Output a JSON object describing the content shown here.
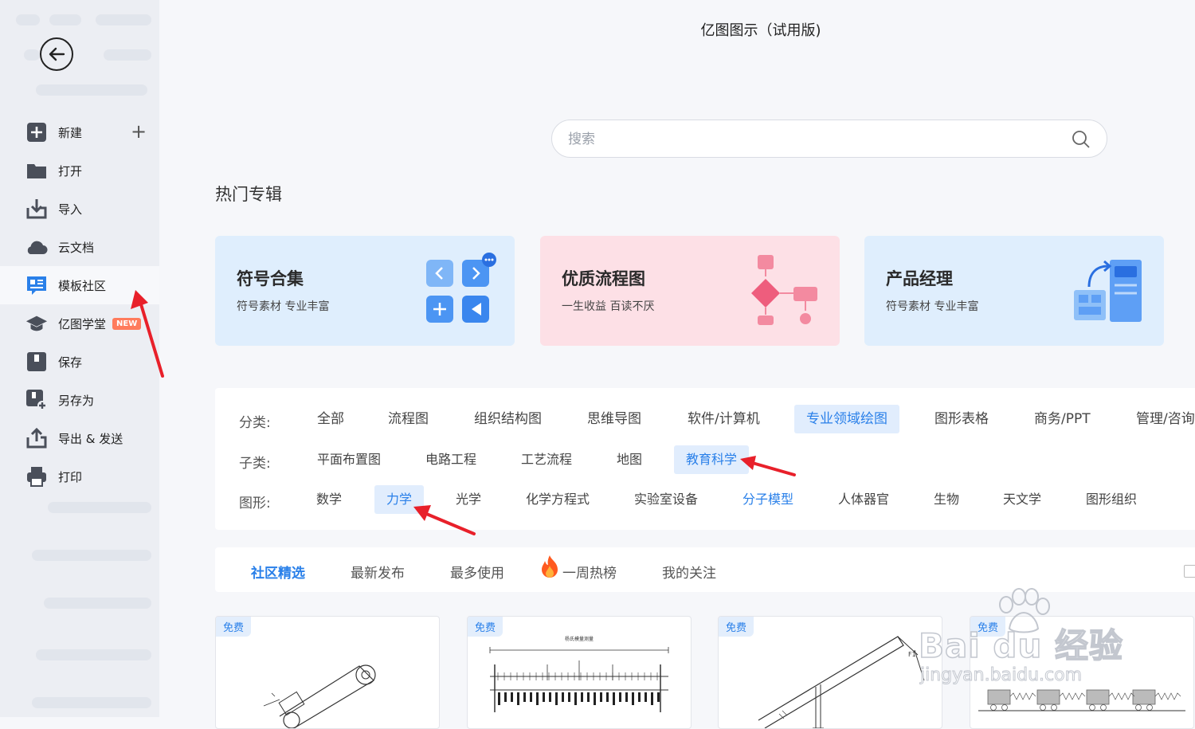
{
  "app_title": "亿图图示（试用版)",
  "sidebar": {
    "items": [
      {
        "label": "新建"
      },
      {
        "label": "打开"
      },
      {
        "label": "导入"
      },
      {
        "label": "云文档"
      },
      {
        "label": "模板社区"
      },
      {
        "label": "亿图学堂",
        "badge": "NEW"
      },
      {
        "label": "保存"
      },
      {
        "label": "另存为"
      },
      {
        "label": "导出 & 发送"
      },
      {
        "label": "打印"
      }
    ],
    "plus": "+"
  },
  "search": {
    "placeholder": "搜索"
  },
  "hot_title": "热门专辑",
  "cards": [
    {
      "title": "符号合集",
      "subtitle": "符号素材 专业丰富",
      "bg": "#dfeefd"
    },
    {
      "title": "优质流程图",
      "subtitle": "一生收益 百读不厌",
      "bg": "#fde0e6"
    },
    {
      "title": "产品经理",
      "subtitle": "符号素材 专业丰富",
      "bg": "#dfeefd"
    }
  ],
  "filters": {
    "category_label": "分类:",
    "categories": [
      "全部",
      "流程图",
      "组织结构图",
      "思维导图",
      "软件/计算机",
      "专业领域绘图",
      "图形表格",
      "商务/PPT",
      "管理/咨询"
    ],
    "sub_label": "子类:",
    "subcategories": [
      "平面布置图",
      "电路工程",
      "工艺流程",
      "地图",
      "教育科学"
    ],
    "shape_label": "图形:",
    "shapes": [
      "数学",
      "力学",
      "光学",
      "化学方程式",
      "实验室设备",
      "分子模型",
      "人体器官",
      "生物",
      "天文学",
      "图形组织"
    ]
  },
  "tabs": [
    "社区精选",
    "最新发布",
    "最多使用",
    "一周热榜",
    "我的关注"
  ],
  "templates": [
    {
      "badge": "免费"
    },
    {
      "badge": "免费",
      "caption": "杨氏模量测量"
    },
    {
      "badge": "免费",
      "label": "F1"
    },
    {
      "badge": "免费"
    }
  ],
  "watermark": {
    "text": "Bai du 经验",
    "url": "jingyan.baidu.com"
  },
  "colors": {
    "accent": "#2a80e9",
    "selected_bg": "#e1edfd",
    "arrow": "#e8202a",
    "badge": "#ff7b5c"
  }
}
